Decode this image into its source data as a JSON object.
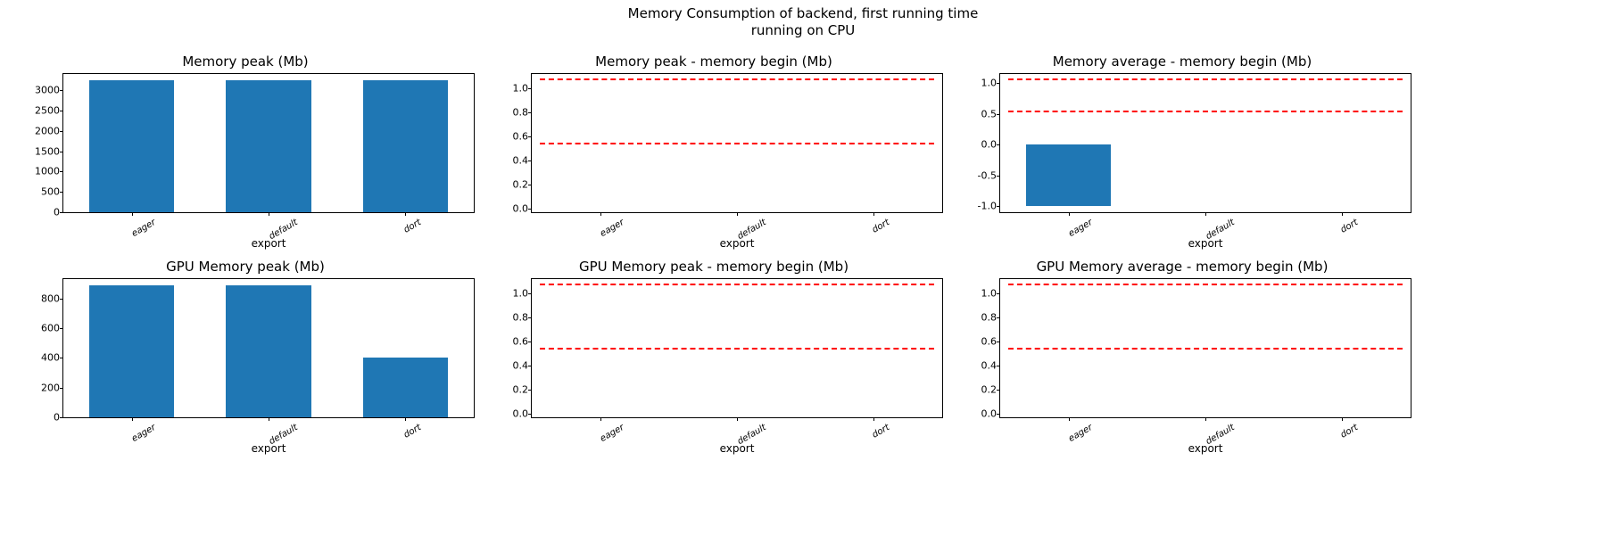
{
  "suptitle": "Memory Consumption of backend, first running time\nrunning on CPU",
  "subplots": [
    {
      "title": "Memory peak (Mb)",
      "xlabel": "export",
      "yticks": [
        0,
        500,
        1000,
        1500,
        2000,
        2500,
        3000
      ],
      "ymin": 0,
      "ymax": 3400,
      "base": 0,
      "categories": [
        "eager",
        "default",
        "dort"
      ],
      "values": [
        3250,
        3250,
        3250
      ],
      "hlines": []
    },
    {
      "title": "Memory peak - memory begin (Mb)",
      "xlabel": "export",
      "yticks": [
        0.0,
        0.2,
        0.4,
        0.6,
        0.8,
        1.0
      ],
      "ymin": -0.03,
      "ymax": 1.12,
      "base": 0,
      "categories": [
        "eager",
        "default",
        "dort"
      ],
      "values": [
        0,
        0,
        0
      ],
      "hlines": [
        0.55,
        1.08
      ]
    },
    {
      "title": "Memory average - memory begin (Mb)",
      "xlabel": "export",
      "yticks": [
        -1.0,
        -0.5,
        0.0,
        0.5,
        1.0
      ],
      "ymin": -1.1,
      "ymax": 1.15,
      "base": 0,
      "categories": [
        "eager",
        "default",
        "dort"
      ],
      "values": [
        -1.0,
        0,
        0
      ],
      "hlines": [
        0.55,
        1.08
      ]
    },
    {
      "title": "GPU Memory peak (Mb)",
      "xlabel": "export",
      "yticks": [
        0,
        200,
        400,
        600,
        800
      ],
      "ymin": 0,
      "ymax": 930,
      "base": 0,
      "categories": [
        "eager",
        "default",
        "dort"
      ],
      "values": [
        890,
        890,
        400
      ],
      "hlines": []
    },
    {
      "title": "GPU Memory peak - memory begin (Mb)",
      "xlabel": "export",
      "yticks": [
        0.0,
        0.2,
        0.4,
        0.6,
        0.8,
        1.0
      ],
      "ymin": -0.03,
      "ymax": 1.12,
      "base": 0,
      "categories": [
        "eager",
        "default",
        "dort"
      ],
      "values": [
        0,
        0,
        0
      ],
      "hlines": [
        0.55,
        1.08
      ]
    },
    {
      "title": "GPU Memory average - memory begin (Mb)",
      "xlabel": "export",
      "yticks": [
        0.0,
        0.2,
        0.4,
        0.6,
        0.8,
        1.0
      ],
      "ymin": -0.03,
      "ymax": 1.12,
      "base": 0,
      "categories": [
        "eager",
        "default",
        "dort"
      ],
      "values": [
        0,
        0,
        0
      ],
      "hlines": [
        0.55,
        1.08
      ]
    }
  ],
  "chart_data": [
    {
      "type": "bar",
      "title": "Memory peak (Mb)",
      "xlabel": "export",
      "ylabel": "",
      "categories": [
        "eager",
        "default",
        "dort"
      ],
      "values": [
        3250,
        3250,
        3250
      ],
      "ylim": [
        0,
        3400
      ]
    },
    {
      "type": "bar",
      "title": "Memory peak - memory begin (Mb)",
      "xlabel": "export",
      "ylabel": "",
      "categories": [
        "eager",
        "default",
        "dort"
      ],
      "values": [
        0,
        0,
        0
      ],
      "ylim": [
        0,
        1.1
      ],
      "reference_lines": [
        0.55,
        1.08
      ]
    },
    {
      "type": "bar",
      "title": "Memory average - memory begin (Mb)",
      "xlabel": "export",
      "ylabel": "",
      "categories": [
        "eager",
        "default",
        "dort"
      ],
      "values": [
        -1.0,
        0,
        0
      ],
      "ylim": [
        -1.1,
        1.1
      ],
      "reference_lines": [
        0.55,
        1.08
      ]
    },
    {
      "type": "bar",
      "title": "GPU Memory peak (Mb)",
      "xlabel": "export",
      "ylabel": "",
      "categories": [
        "eager",
        "default",
        "dort"
      ],
      "values": [
        890,
        890,
        400
      ],
      "ylim": [
        0,
        930
      ]
    },
    {
      "type": "bar",
      "title": "GPU Memory peak - memory begin (Mb)",
      "xlabel": "export",
      "ylabel": "",
      "categories": [
        "eager",
        "default",
        "dort"
      ],
      "values": [
        0,
        0,
        0
      ],
      "ylim": [
        0,
        1.1
      ],
      "reference_lines": [
        0.55,
        1.08
      ]
    },
    {
      "type": "bar",
      "title": "GPU Memory average - memory begin (Mb)",
      "xlabel": "export",
      "ylabel": "",
      "categories": [
        "eager",
        "default",
        "dort"
      ],
      "values": [
        0,
        0,
        0
      ],
      "ylim": [
        0,
        1.1
      ],
      "reference_lines": [
        0.55,
        1.08
      ]
    }
  ]
}
